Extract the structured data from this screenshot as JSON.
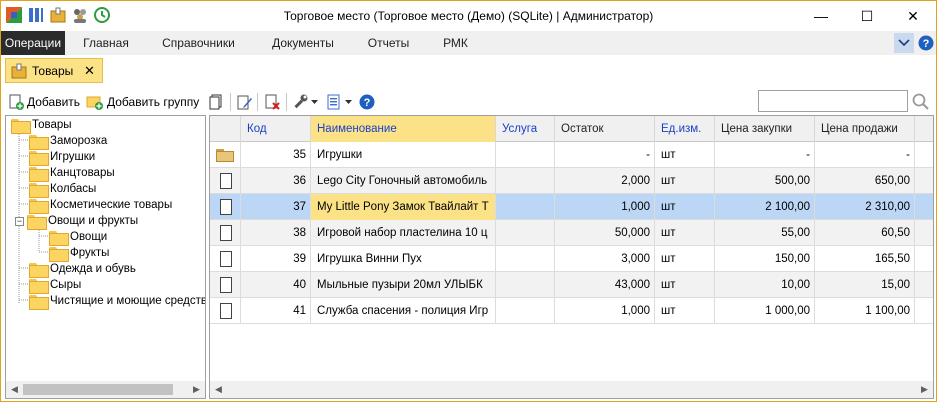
{
  "window": {
    "title": "Торговое место (Торговое место (Демо) (SQLite) | Администратор)",
    "minimize_glyph": "—",
    "maximize_glyph": "☐",
    "close_glyph": "✕"
  },
  "menu": {
    "tabs": [
      "Операции",
      "Главная",
      "Справочники",
      "Документы",
      "Отчеты",
      "РМК"
    ],
    "active": "Операции"
  },
  "doc_tab": {
    "label": "Товары",
    "close_glyph": "✕"
  },
  "toolbar": {
    "add_label": "Добавить",
    "add_group_label": "Добавить группу",
    "search_value": ""
  },
  "tree": {
    "root": "Товары",
    "items": [
      "Заморозка",
      "Игрушки",
      "Канцтовары",
      "Колбасы",
      "Косметические товары",
      "Овощи и фрукты",
      "Овощи",
      "Фрукты",
      "Одежда и обувь",
      "Сыры",
      "Чистящие и моющие средства"
    ],
    "expander_glyph": "−"
  },
  "grid": {
    "headers": [
      "Код",
      "Наименование",
      "Услуга",
      "Остаток",
      "Ед.изм.",
      "Цена закупки",
      "Цена продажи"
    ],
    "rows": [
      [
        "35",
        "Игрушки",
        "",
        "-",
        "шт",
        "-",
        "-"
      ],
      [
        "36",
        "Lego City Гоночный автомобиль",
        "",
        "2,000",
        "шт",
        "500,00",
        "650,00"
      ],
      [
        "37",
        "My Little Pony Замок Твайлайт Т",
        "",
        "1,000",
        "шт",
        "2 100,00",
        "2 310,00"
      ],
      [
        "38",
        "Игровой набор пластелина 10 ц",
        "",
        "50,000",
        "шт",
        "55,00",
        "60,50"
      ],
      [
        "39",
        "Игрушка Винни Пух",
        "",
        "3,000",
        "шт",
        "150,00",
        "165,50"
      ],
      [
        "40",
        "Мыльные пузыри 20мл УЛЫБК",
        "",
        "43,000",
        "шт",
        "10,00",
        "15,00"
      ],
      [
        "41",
        "Служба спасения - полиция Игр",
        "",
        "1,000",
        "шт",
        "1 000,00",
        "1 100,00"
      ]
    ],
    "selected_row": 2,
    "scroll_left_glyph": "◀",
    "scroll_right_glyph": "▶"
  },
  "colors": {
    "accent": "#fce287",
    "selection": "#bcd7f5",
    "link": "#1a40c8",
    "window_border": "#e3a21a"
  }
}
